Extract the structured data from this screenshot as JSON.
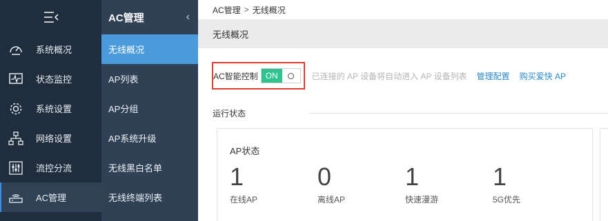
{
  "sidebar": {
    "items": [
      {
        "label": "系统概况",
        "icon": "dashboard-icon"
      },
      {
        "label": "状态监控",
        "icon": "monitor-icon"
      },
      {
        "label": "系统设置",
        "icon": "gear-icon"
      },
      {
        "label": "网络设置",
        "icon": "network-icon"
      },
      {
        "label": "流控分流",
        "icon": "sliders-icon"
      },
      {
        "label": "AC管理",
        "icon": "router-icon"
      }
    ],
    "active_index": 5
  },
  "subnav": {
    "title": "AC管理",
    "items": [
      {
        "label": "无线概况"
      },
      {
        "label": "AP列表"
      },
      {
        "label": "AP分组"
      },
      {
        "label": "AP系统升级"
      },
      {
        "label": "无线黑白名单"
      },
      {
        "label": "无线终端列表"
      }
    ],
    "active_index": 0
  },
  "breadcrumb": {
    "parent": "AC管理",
    "separator": ">",
    "current": "无线概况"
  },
  "page_title": "无线概况",
  "ac_control": {
    "label": "AC智能控制",
    "toggle_label": "ON",
    "hint": "已连接的 AP 设备将自动进入 AP 设备列表",
    "link_manage": "管理配置",
    "link_buy": "购买爱快 AP"
  },
  "run_status": {
    "section_label": "运行状态",
    "card_title": "AP状态",
    "stats": [
      {
        "value": "1",
        "label": "在线AP"
      },
      {
        "value": "0",
        "label": "离线AP"
      },
      {
        "value": "1",
        "label": "快速漫游"
      },
      {
        "value": "1",
        "label": "5G优先"
      }
    ]
  },
  "colors": {
    "sidebar_bg": "#1f2d3d",
    "subnav_bg": "#304156",
    "active_blue": "#4a9bdb",
    "toggle_green": "#2fc38f",
    "highlight_red": "#e03c31",
    "link_blue": "#2a8ac9"
  }
}
